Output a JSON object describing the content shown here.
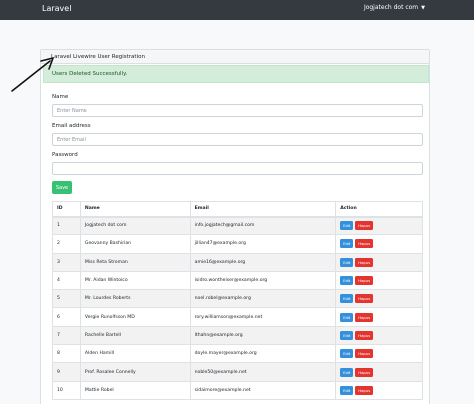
{
  "navbar": {
    "brand": "Laravel",
    "user": "Jogjatech dot com",
    "user_caret_icon": "caret-down-icon",
    "background": "#343a40"
  },
  "card": {
    "title": "Laravel Livewire User Registration"
  },
  "alert": {
    "message": "Users Deleted Successfully.",
    "background": "#d4edda",
    "text_color": "#155724"
  },
  "form": {
    "name_label": "Name",
    "name_placeholder": "Enter Name",
    "email_label": "Email address",
    "email_placeholder": "Enter Email",
    "password_label": "Password",
    "password_placeholder": "",
    "save_label": "Save",
    "save_color": "#38c172"
  },
  "table": {
    "headers": [
      "ID",
      "Name",
      "Email",
      "Action"
    ],
    "edit_label": "Edit",
    "delete_label": "Hapus",
    "edit_color": "#3490dc",
    "delete_color": "#e3342f",
    "rows": [
      {
        "id": "1",
        "name": "Jogjatech dot com",
        "email": "info.jogjatech@gmail.com"
      },
      {
        "id": "2",
        "name": "Geovanny Bashirian",
        "email": "jillian47@example.org"
      },
      {
        "id": "3",
        "name": "Miss Reta Stroman",
        "email": "amie16@example.org"
      },
      {
        "id": "4",
        "name": "Mr. Aidan Wintoico",
        "email": "isidro.wontheiser@example.org"
      },
      {
        "id": "5",
        "name": "Mr. Lourdes Roberts",
        "email": "noel.robel@example.org"
      },
      {
        "id": "6",
        "name": "Vergie Runolfsson MD",
        "email": "rory.williamson@example.net"
      },
      {
        "id": "7",
        "name": "Rachelle Bartell",
        "email": "lthahn@example.org"
      },
      {
        "id": "8",
        "name": "Alden Hamill",
        "email": "doyle.mayer@example.org"
      },
      {
        "id": "9",
        "name": "Prof. Rosalee Connelly",
        "email": "noble50@example.net"
      },
      {
        "id": "10",
        "name": "Mattie Robel",
        "email": "sidaimore@example.net"
      }
    ]
  },
  "annotation": {
    "arrow_icon": "arrow-icon"
  }
}
